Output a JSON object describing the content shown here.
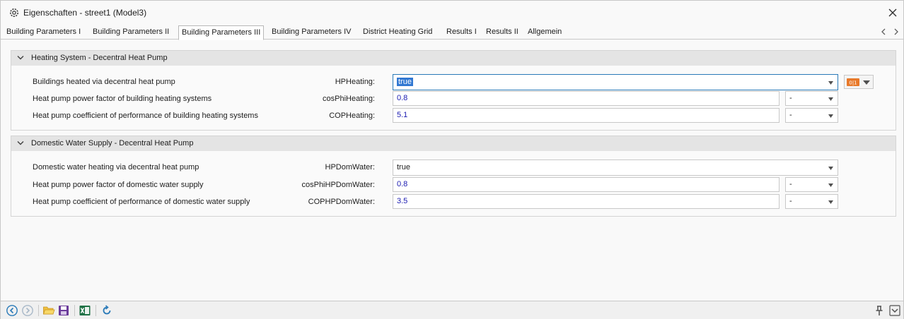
{
  "window": {
    "title": "Eigenschaften - street1 (Model3)"
  },
  "tabs": [
    {
      "label": "Building Parameters I",
      "active": false
    },
    {
      "label": "Building Parameters II",
      "active": false
    },
    {
      "label": "Building Parameters III",
      "active": true
    },
    {
      "label": "Building Parameters IV",
      "active": false
    },
    {
      "label": "District Heating Grid",
      "active": false
    },
    {
      "label": "Results I",
      "active": false
    },
    {
      "label": "Results II",
      "active": false
    },
    {
      "label": "Allgemein",
      "active": false
    }
  ],
  "groups": [
    {
      "title": "Heating System - Decentral Heat Pump",
      "rows": [
        {
          "label": "Buildings heated via decentral heat pump",
          "var": "HPHeating:",
          "value": "true",
          "unit": ""
        },
        {
          "label": "Heat pump power factor of building heating systems",
          "var": "cosPhiHeating:",
          "value": "0.8",
          "unit": "-"
        },
        {
          "label": "Heat pump coefficient of performance of building heating systems",
          "var": "COPHeating:",
          "value": "5.1",
          "unit": "-"
        }
      ]
    },
    {
      "title": "Domestic Water Supply - Decentral Heat Pump",
      "rows": [
        {
          "label": "Domestic water heating via decentral heat pump",
          "var": "HPDomWater:",
          "value": "true",
          "unit": ""
        },
        {
          "label": "Heat pump power factor of domestic water supply",
          "var": "cosPhiHPDomWater:",
          "value": "0.8",
          "unit": "-"
        },
        {
          "label": "Heat pump coefficient of performance of domestic water supply",
          "var": "COPHPDomWater:",
          "value": "3.5",
          "unit": "-"
        }
      ]
    }
  ],
  "colors": {
    "accent": "#2a7ab8",
    "value_text": "#1a1ab0",
    "selection": "#3278d2",
    "excel_green": "#1e7145",
    "formula_orange": "#e8792a"
  },
  "icons": [
    "settings-gear-icon",
    "close-icon",
    "back-icon",
    "forward-icon",
    "open-folder-icon",
    "save-icon",
    "excel-icon",
    "refresh-icon",
    "pin-icon",
    "expand-icon",
    "formula-icon"
  ]
}
